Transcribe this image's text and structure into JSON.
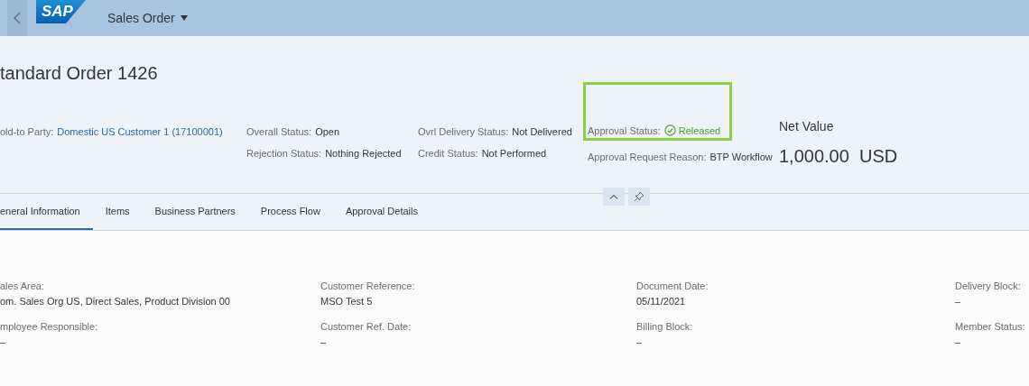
{
  "shell": {
    "app_title": "Sales Order",
    "logo": "SAP"
  },
  "header": {
    "title": "tandard Order 1426",
    "columns": [
      [
        {
          "label": "old-to Party:",
          "value": "Domestic US Customer 1 (17100001)",
          "kind": "link",
          "highlighted": false
        }
      ],
      [
        {
          "label": "Overall Status:",
          "value": "Open",
          "kind": "text",
          "highlighted": false
        },
        {
          "label": "Rejection Status:",
          "value": "Nothing Rejected",
          "kind": "text",
          "highlighted": false
        }
      ],
      [
        {
          "label": "Ovrl Delivery Status:",
          "value": "Not Delivered",
          "kind": "text",
          "highlighted": false
        },
        {
          "label": "Credit Status:",
          "value": "Not Performed",
          "kind": "text",
          "highlighted": false
        }
      ],
      [
        {
          "label": "Approval Status:",
          "value": "Released",
          "kind": "success",
          "highlighted": true
        },
        {
          "label": "Approval Request Reason:",
          "value": "BTP Workflow",
          "kind": "text",
          "highlighted": false
        }
      ]
    ],
    "net_value": {
      "label": "Net Value",
      "amount": "1,000.00",
      "currency": "USD"
    }
  },
  "tabs": [
    {
      "label": "eneral Information",
      "selected": true
    },
    {
      "label": "Items",
      "selected": false
    },
    {
      "label": "Business Partners",
      "selected": false
    },
    {
      "label": "Process Flow",
      "selected": false
    },
    {
      "label": "Approval Details",
      "selected": false
    }
  ],
  "fields": [
    [
      {
        "label": "ales Area:",
        "value": "om. Sales Org US, Direct Sales, Product Division 00"
      },
      {
        "label": "mployee Responsible:",
        "value": "–"
      }
    ],
    [
      {
        "label": "Customer Reference:",
        "value": "MSO Test 5"
      },
      {
        "label": "Customer Ref. Date:",
        "value": "–"
      }
    ],
    [
      {
        "label": "Document Date:",
        "value": "05/11/2021"
      },
      {
        "label": "Billing Block:",
        "value": "–"
      }
    ],
    [
      {
        "label": "Delivery Block:",
        "value": "–"
      },
      {
        "label": "Member Status:",
        "value": "–"
      }
    ]
  ]
}
